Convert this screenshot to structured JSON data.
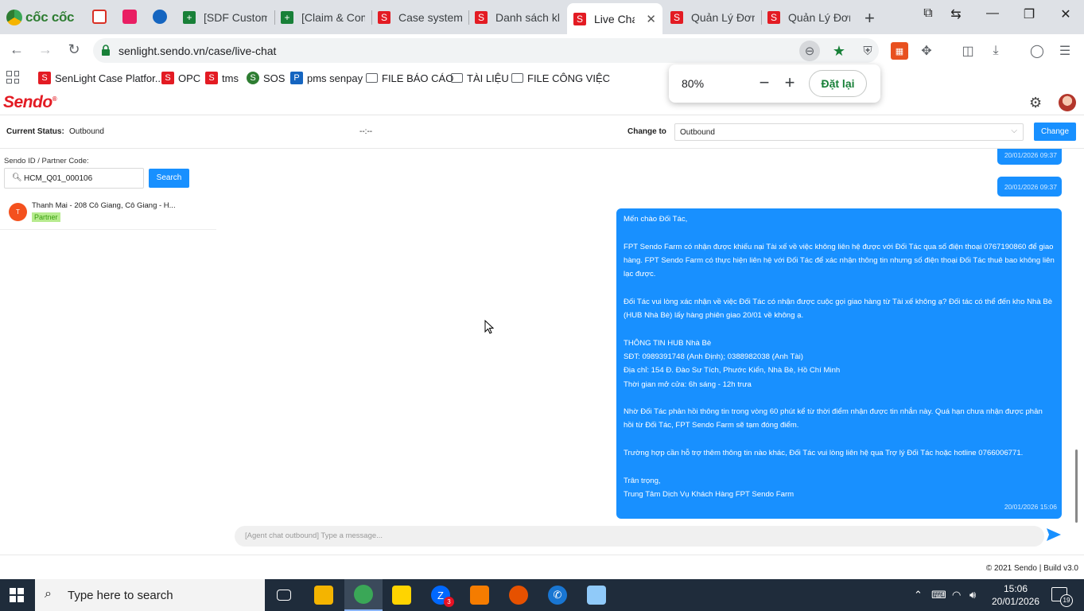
{
  "browser": {
    "brand": "cốc cốc",
    "tabs": [
      {
        "label": "[SDF Custome",
        "icon": "sheets-icon"
      },
      {
        "label": "[Claim & Com",
        "icon": "sheets-icon"
      },
      {
        "label": "Case system |",
        "icon": "sendo-icon"
      },
      {
        "label": "Danh sách khi",
        "icon": "sendo-icon"
      },
      {
        "label": "Live Chat",
        "icon": "sendo-icon",
        "active": true
      },
      {
        "label": "Quản Lý Đơn",
        "icon": "sendo-icon"
      },
      {
        "label": "Quản Lý Đơn",
        "icon": "sendo-icon"
      }
    ],
    "url": "senlight.sendo.vn/case/live-chat",
    "bookmarks": [
      {
        "label": "SenLight Case Platfor...",
        "icon": "sendo-icon"
      },
      {
        "label": "OPC",
        "icon": "sendo-icon"
      },
      {
        "label": "tms",
        "icon": "sendo-icon"
      },
      {
        "label": "SOS",
        "icon": "sos-icon"
      },
      {
        "label": "pms senpay",
        "icon": "senpay-icon"
      },
      {
        "label": "FILE BÁO CÁO",
        "icon": "folder-icon"
      },
      {
        "label": "TÀI LIỆU",
        "icon": "folder-icon"
      },
      {
        "label": "FILE CÔNG VIỆC",
        "icon": "folder-icon"
      }
    ],
    "zoom": {
      "percent": "80%",
      "reset_label": "Đặt lại"
    }
  },
  "app": {
    "logo": "Sendo",
    "status": {
      "current_label": "Current Status:",
      "current_value": "Outbound",
      "timer": "--:--",
      "change_to_label": "Change to",
      "change_to_value": "Outbound",
      "change_button": "Change"
    },
    "search": {
      "label": "Sendo ID / Partner Code:",
      "value": "HCM_Q01_000106",
      "button": "Search"
    },
    "contact": {
      "initial": "T",
      "name": "Thanh Mai - 208 Cô Giang, Cô Giang - H...",
      "tag": "Partner"
    },
    "messages": {
      "small": [
        {
          "time": "20/01/2026 09:37"
        },
        {
          "time": "20/01/2026 09:37"
        }
      ],
      "main": {
        "lines": [
          "Mến chào Đối Tác,",
          "",
          "FPT Sendo Farm có nhận được khiếu nại Tài xế về việc không liên hệ được với Đối Tác qua số điện thoại 0767190860 để giao hàng. FPT Sendo Farm có thực hiện liên hệ với Đối Tác để xác nhận thông tin nhưng số điện thoại Đối Tác thuê bao không liên lạc được.",
          "",
          "Đối Tác vui lòng xác nhận về việc Đối Tác có nhận được cuộc gọi giao hàng từ Tài xế không ạ? Đối tác có thể đến kho Nhà Bè (HUB Nhà Bè) lấy hàng phiên giao 20/01 về không ạ.",
          "",
          "THÔNG TIN HUB Nhà Bè",
          "SĐT: 0989391748 (Anh Định); 0388982038 (Anh Tài)",
          "Địa chỉ: 154 Đ. Đào Sư Tích, Phước Kiển, Nhà Bè, Hồ Chí Minh",
          "Thời gian mở cửa: 6h sáng - 12h trưa",
          "",
          "Nhờ Đối Tác phản hồi thông tin trong vòng 60 phút kể từ thời điểm nhận được tin nhắn này. Quá hạn chưa nhận được phản hồi từ Đối Tác, FPT Sendo Farm sẽ tạm đóng điểm.",
          "",
          "Trường hợp cần hỗ trợ thêm thông tin nào khác, Đối Tác vui lòng liên hệ qua Trợ lý Đối Tác hoặc hotline 0766006771.",
          "",
          "Trân trọng,",
          "Trung Tâm Dịch Vụ Khách Hàng FPT Sendo Farm"
        ],
        "time": "20/01/2026 15:06"
      }
    },
    "composer_placeholder": "[Agent chat outbound] Type a message...",
    "footer": "© 2021 Sendo | Build v3.0"
  },
  "taskbar": {
    "search_placeholder": "Type here to search",
    "zalo_badge": "3",
    "time": "15:06",
    "date": "20/01/2026",
    "notifications": "19"
  }
}
